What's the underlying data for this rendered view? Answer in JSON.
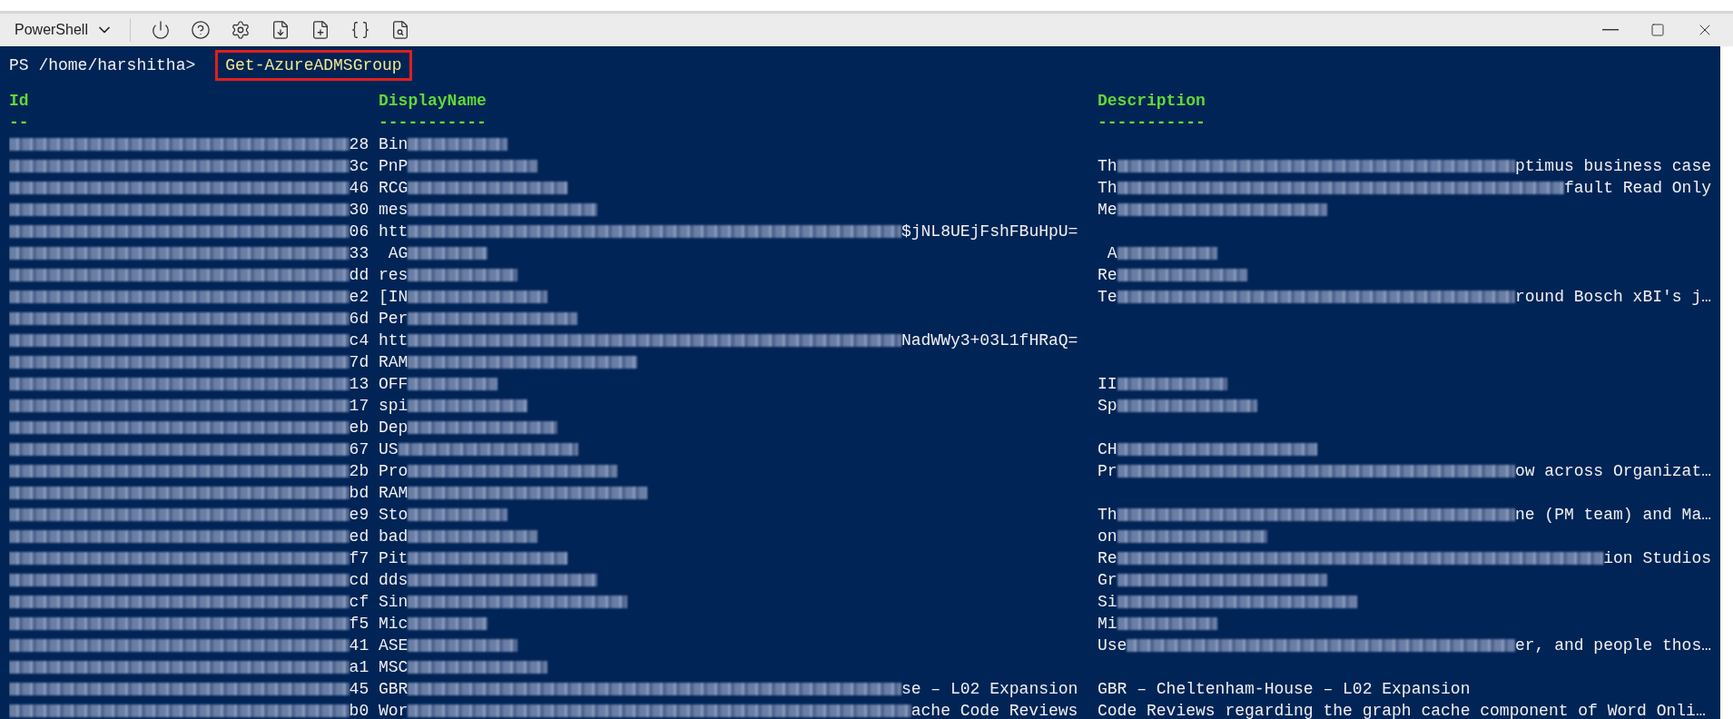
{
  "shell_selector": {
    "label": "PowerShell"
  },
  "prompt": {
    "path": "PS /home/harshitha>",
    "command": "Get-AzureADMSGroup",
    "highlighted": true
  },
  "table": {
    "columns": [
      {
        "header": "Id",
        "underline": "--"
      },
      {
        "header": "DisplayName",
        "underline": "-----------"
      },
      {
        "header": "Description",
        "underline": "-----------"
      }
    ],
    "rows": [
      {
        "id_end": "28",
        "name": "Bin"
      },
      {
        "id_end": "3c",
        "name": "PnP",
        "description": "Th",
        "description_end": "ptimus business case"
      },
      {
        "id_end": "46",
        "name": "RCG",
        "description": "Th",
        "description_end": "fault Read Only"
      },
      {
        "id_end": "30",
        "name": "mes",
        "description": "Me"
      },
      {
        "id_end": "06",
        "name": "htt",
        "name_end": "$jNL8UEjFshFBuHpU="
      },
      {
        "id_end": "33",
        "name": " AG",
        "description": " A"
      },
      {
        "id_end": "dd",
        "name": "res",
        "description": "Re"
      },
      {
        "id_end": "e2",
        "name": "[IN",
        "description": "Te",
        "description_end": "round Bosch xBI's j…"
      },
      {
        "id_end": "6d",
        "name": "Per"
      },
      {
        "id_end": "c4",
        "name": "htt",
        "name_end": "NadWWy3+03L1fHRaQ="
      },
      {
        "id_end": "7d",
        "name": "RAM"
      },
      {
        "id_end": "13",
        "name": "OFF",
        "description": "II"
      },
      {
        "id_end": "17",
        "name": "spi",
        "description": "Sp"
      },
      {
        "id_end": "eb",
        "name": "Dep"
      },
      {
        "id_end": "67",
        "name": "US",
        "description": "CH"
      },
      {
        "id_end": "2b",
        "name": "Pro",
        "description": "Pr",
        "description_end": "ow across Organizat…"
      },
      {
        "id_end": "bd",
        "name": "RAM"
      },
      {
        "id_end": "e9",
        "name": "Sto",
        "description": "Th",
        "description_end": "ne (PM team) and Ma…"
      },
      {
        "id_end": "ed",
        "name": "bad",
        "description": "on"
      },
      {
        "id_end": "f7",
        "name": "Pit",
        "description": "Re",
        "description_end": "ion Studios"
      },
      {
        "id_end": "cd",
        "name": "dds",
        "description": "Gr"
      },
      {
        "id_end": "cf",
        "name": "Sin",
        "description": "Si"
      },
      {
        "id_end": "f5",
        "name": "Mic",
        "description": "Mi"
      },
      {
        "id_end": "41",
        "name": "ASE",
        "description": "Use",
        "description_end": "er, and people thos…"
      },
      {
        "id_end": "a1",
        "name": "MSC"
      },
      {
        "id_end": "45",
        "name": "GBR",
        "name_end": "se – L02 Expansion",
        "description": "GBR – Cheltenham-House – L02 Expansion"
      },
      {
        "id_end": "b0",
        "name": "Wor",
        "name_end": "ache Code Reviews",
        "description": "Code Reviews regarding the graph cache component of Word Onli…"
      }
    ]
  }
}
